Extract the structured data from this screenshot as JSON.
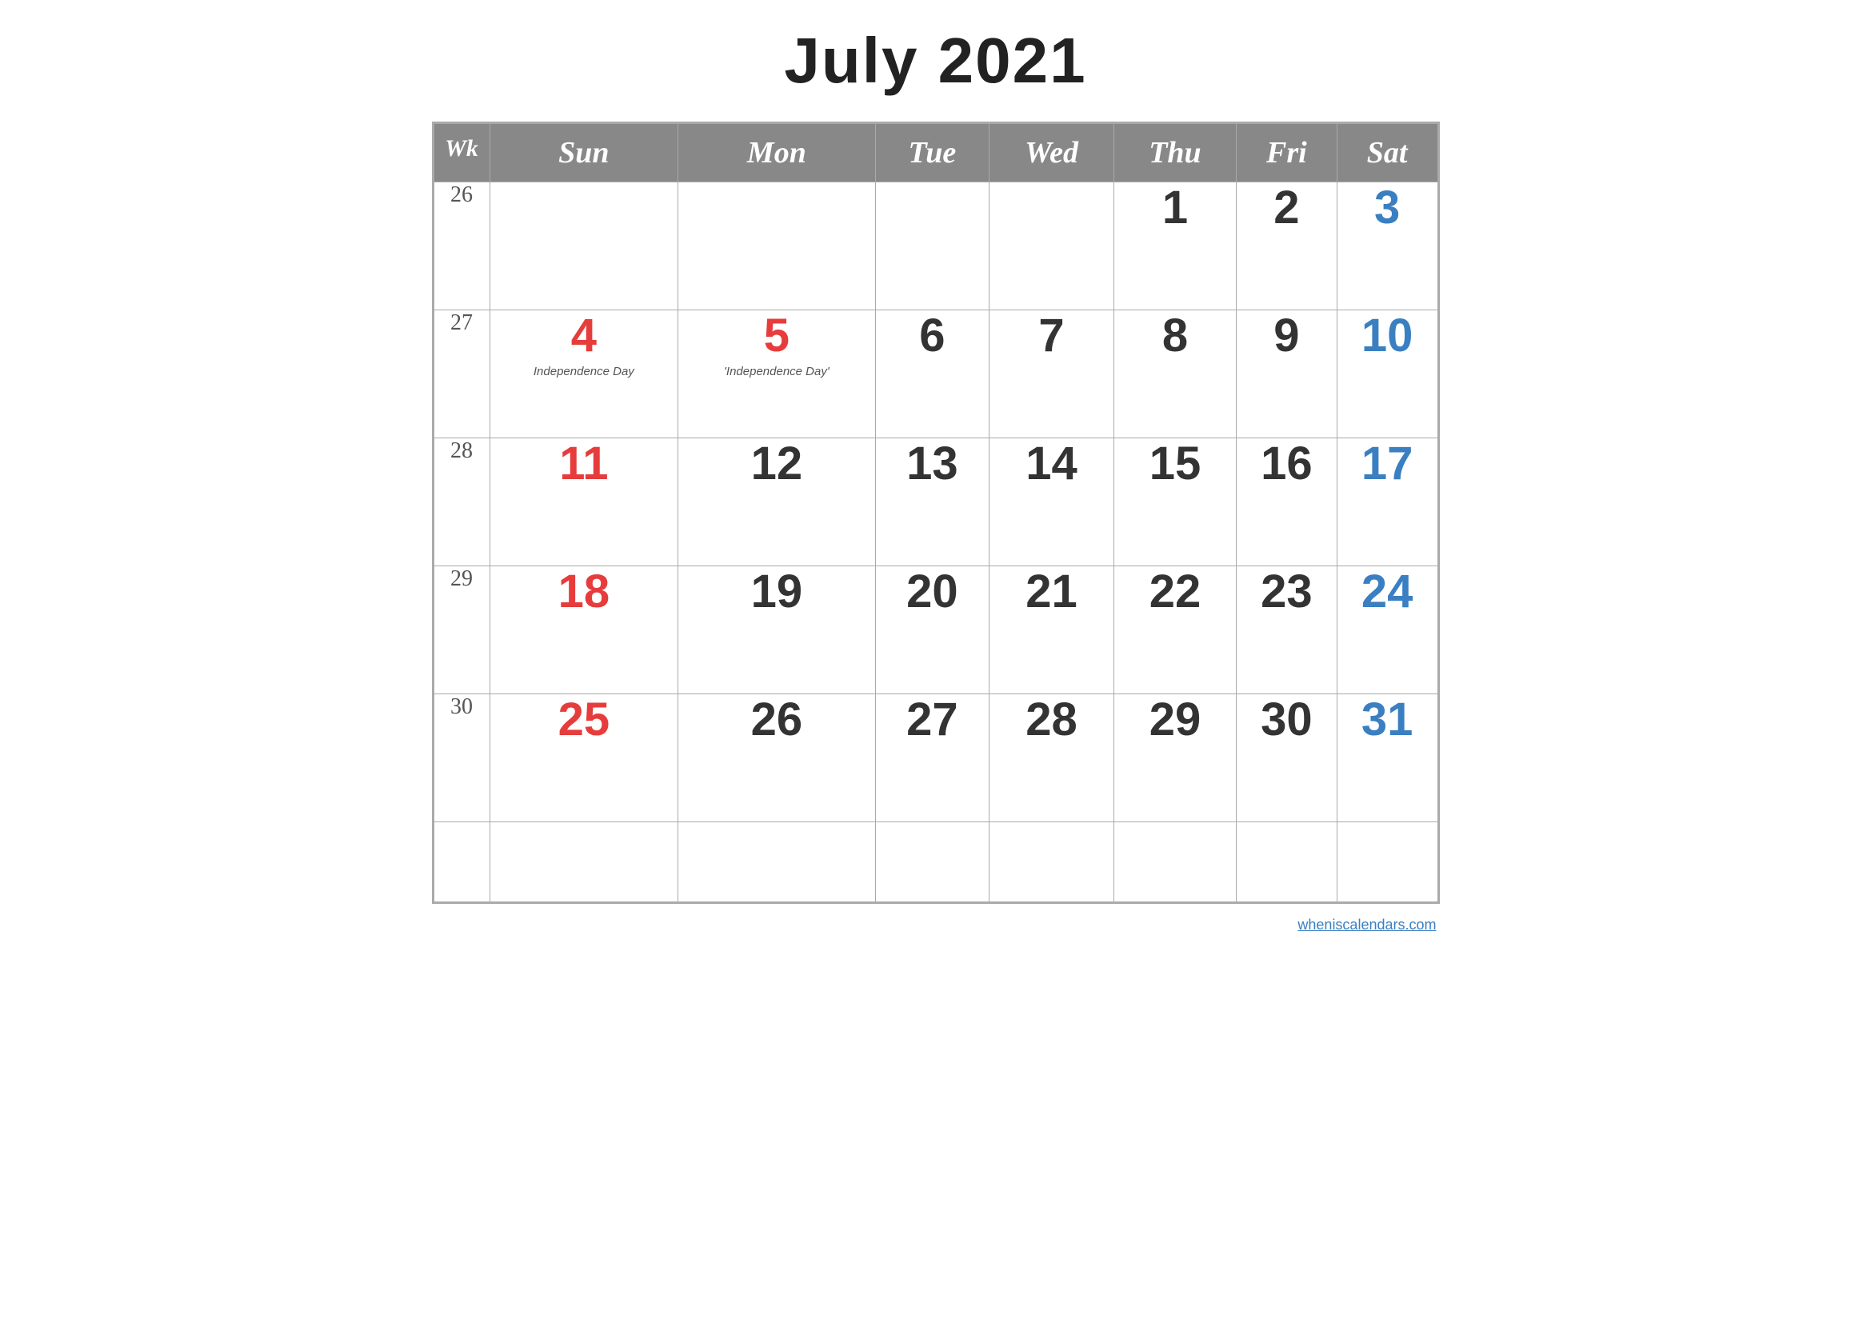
{
  "title": "July 2021",
  "header": {
    "wk": "Wk",
    "days": [
      "Sun",
      "Mon",
      "Tue",
      "Wed",
      "Thu",
      "Fri",
      "Sat"
    ]
  },
  "weeks": [
    {
      "wk": "26",
      "days": [
        {
          "num": "",
          "type": "empty"
        },
        {
          "num": "",
          "type": "empty"
        },
        {
          "num": "",
          "type": "empty"
        },
        {
          "num": "",
          "type": "empty"
        },
        {
          "num": "1",
          "type": "normal"
        },
        {
          "num": "2",
          "type": "normal"
        },
        {
          "num": "3",
          "type": "saturday"
        }
      ]
    },
    {
      "wk": "27",
      "days": [
        {
          "num": "4",
          "type": "sunday",
          "holiday": "Independence Day"
        },
        {
          "num": "5",
          "type": "holiday-red",
          "holiday": "'Independence Day'"
        },
        {
          "num": "6",
          "type": "normal"
        },
        {
          "num": "7",
          "type": "normal"
        },
        {
          "num": "8",
          "type": "normal"
        },
        {
          "num": "9",
          "type": "normal"
        },
        {
          "num": "10",
          "type": "saturday"
        }
      ]
    },
    {
      "wk": "28",
      "days": [
        {
          "num": "11",
          "type": "sunday"
        },
        {
          "num": "12",
          "type": "normal"
        },
        {
          "num": "13",
          "type": "normal"
        },
        {
          "num": "14",
          "type": "normal"
        },
        {
          "num": "15",
          "type": "normal"
        },
        {
          "num": "16",
          "type": "normal"
        },
        {
          "num": "17",
          "type": "saturday"
        }
      ]
    },
    {
      "wk": "29",
      "days": [
        {
          "num": "18",
          "type": "sunday"
        },
        {
          "num": "19",
          "type": "normal"
        },
        {
          "num": "20",
          "type": "normal"
        },
        {
          "num": "21",
          "type": "normal"
        },
        {
          "num": "22",
          "type": "normal"
        },
        {
          "num": "23",
          "type": "normal"
        },
        {
          "num": "24",
          "type": "saturday"
        }
      ]
    },
    {
      "wk": "30",
      "days": [
        {
          "num": "25",
          "type": "sunday"
        },
        {
          "num": "26",
          "type": "normal"
        },
        {
          "num": "27",
          "type": "normal"
        },
        {
          "num": "28",
          "type": "normal"
        },
        {
          "num": "29",
          "type": "normal"
        },
        {
          "num": "30",
          "type": "normal"
        },
        {
          "num": "31",
          "type": "saturday"
        }
      ]
    }
  ],
  "footer": {
    "watermark": "wheniscalendars.com"
  }
}
